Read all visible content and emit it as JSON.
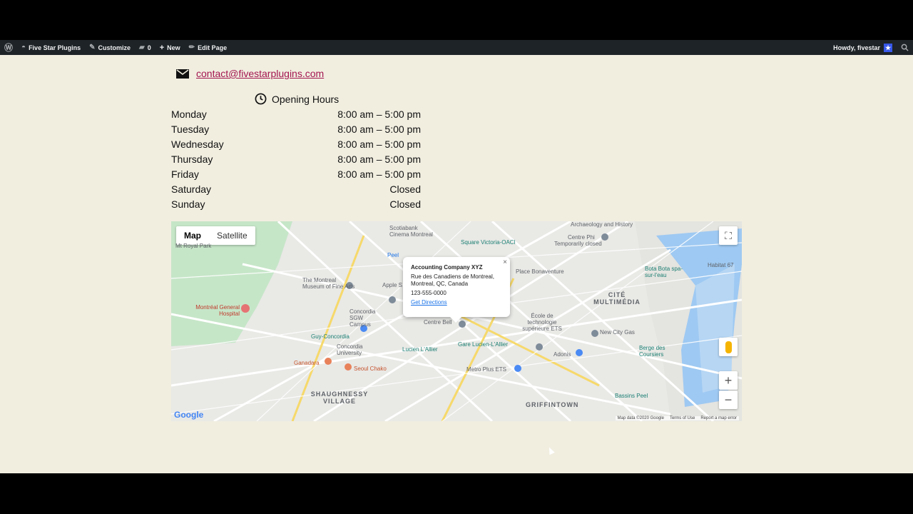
{
  "adminbar": {
    "site_name": "Five Star Plugins",
    "customize": "Customize",
    "comments_count": "0",
    "new": "New",
    "edit_page": "Edit Page",
    "howdy": "Howdy, fivestar"
  },
  "contact": {
    "email": "contact@fivestarplugins.com"
  },
  "hours": {
    "title": "Opening Hours",
    "rows": [
      {
        "day": "Monday",
        "time": "8:00 am – 5:00 pm"
      },
      {
        "day": "Tuesday",
        "time": "8:00 am – 5:00 pm"
      },
      {
        "day": "Wednesday",
        "time": "8:00 am – 5:00 pm"
      },
      {
        "day": "Thursday",
        "time": "8:00 am – 5:00 pm"
      },
      {
        "day": "Friday",
        "time": "8:00 am – 5:00 pm"
      },
      {
        "day": "Saturday",
        "time": "Closed"
      },
      {
        "day": "Sunday",
        "time": "Closed"
      }
    ]
  },
  "map": {
    "type_map": "Map",
    "type_satellite": "Satellite",
    "infowindow": {
      "title": "Accounting Company XYZ",
      "address_line1": "Rue des Canadiens de Montreal,",
      "address_line2": "Montreal, QC, Canada",
      "phone": "123-555-0000",
      "directions": "Get Directions",
      "close": "×"
    },
    "labels": {
      "scotiabank": "Scotiabank",
      "cinema": "Cinema Montreal",
      "peel": "Peel",
      "square_victoria": "Square Victoria-OACI",
      "centre_phi": "Centre Phi",
      "temp_closed": "Temporarily closed",
      "place_bonaventure": "Place Bonaventure",
      "museum": "The Montreal Museum of Fine Arts",
      "apple": "Apple S",
      "concordia_sgw": "Concordia SGW Campus",
      "guy_concordia": "Guy-Concordia",
      "concordia_univ": "Concordia University",
      "centre_bell": "Centre Bell",
      "ecole": "École de technologie supérieure ETS",
      "cite": "CITÉ MULTIMÉDIA",
      "new_city_gas": "New City Gas",
      "lucien": "Lucien L'Allier",
      "gare": "Gare Lucien-L'Allier",
      "adonis": "Adonis",
      "ganadara": "Ganadara",
      "seoul_chako": "Seoul Chako",
      "metro_plus": "Metro Plus ETS",
      "shaughnessy": "SHAUGHNESSY VILLAGE",
      "griffintown": "GRIFFINTOWN",
      "bota": "Bota Bota spa-sur-l'eau",
      "bassin_peel": "Bassins Peel",
      "berge": "Berge des Coursiers",
      "hospital": "Montréal General Hospital",
      "habitat": "Habitat 67",
      "mount_royal": "Mt Royal Park",
      "archaeology": "Archaeology and History"
    },
    "attribution": {
      "logo": "Google",
      "mapdata": "Map data ©2020 Google",
      "terms": "Terms of Use",
      "report": "Report a map error"
    }
  }
}
